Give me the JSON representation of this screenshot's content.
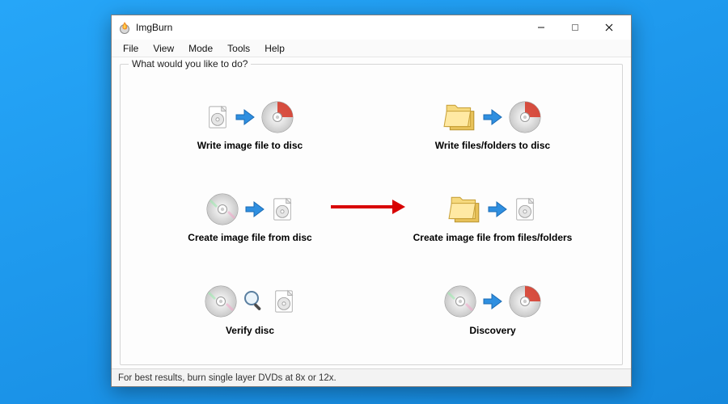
{
  "window": {
    "title": "ImgBurn"
  },
  "menu": {
    "file": "File",
    "view": "View",
    "mode": "Mode",
    "tools": "Tools",
    "help": "Help"
  },
  "group": {
    "legend": "What would you like to do?"
  },
  "actions": {
    "write_image_to_disc": "Write image file to disc",
    "write_files_to_disc": "Write files/folders to disc",
    "create_image_from_disc": "Create image file from disc",
    "create_image_from_files": "Create image file from files/folders",
    "verify_disc": "Verify disc",
    "discovery": "Discovery"
  },
  "status": {
    "tip": "For best results, burn single layer DVDs at 8x or 12x."
  }
}
